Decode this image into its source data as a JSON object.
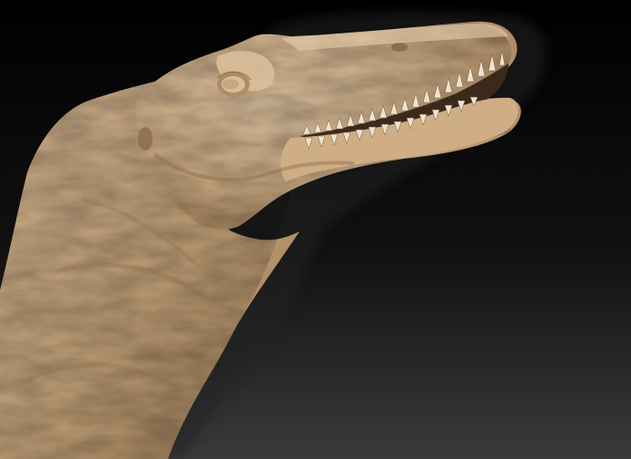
{
  "scene": {
    "subject": "dinosaur-head-sculpt",
    "colors": {
      "background_top": "#000000",
      "background_bottom": "#3a3a3a",
      "clay_light": "#d8bd98",
      "clay_mid": "#c2a077",
      "clay_dark": "#8c6d4a",
      "shadow": "#1a1a1a",
      "tooth": "#efe3cf",
      "mouth_interior": "#3b2a1b"
    }
  }
}
